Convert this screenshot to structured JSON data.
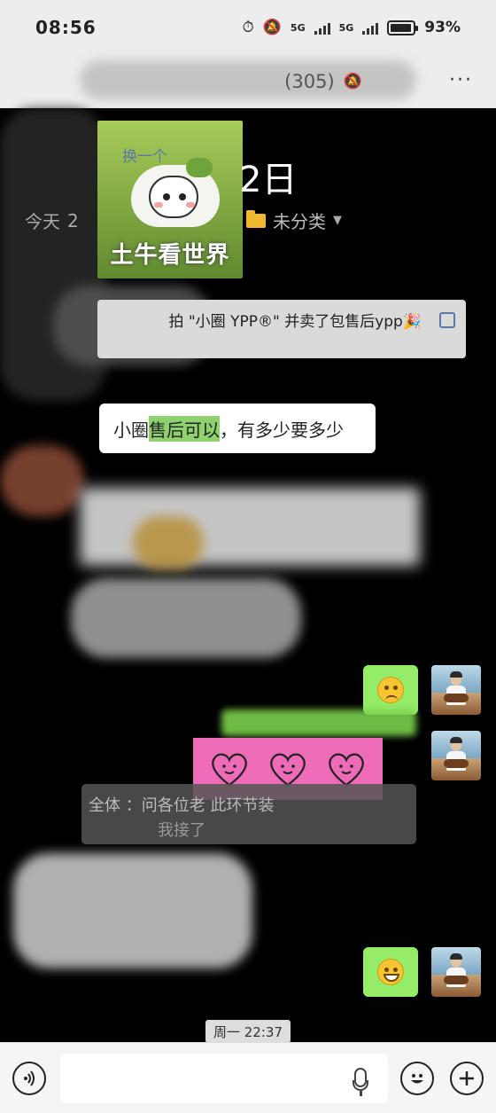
{
  "status_bar": {
    "time": "08:56",
    "signal_1": "5G",
    "signal_2": "5G",
    "battery": "93%"
  },
  "title_bar": {
    "title": "(305)",
    "more_label": "···"
  },
  "note": {
    "sticker_text": "土牛看世界",
    "date_fragment": "2日",
    "meta_today": "今天",
    "meta_today_suffix": "2",
    "folder_label": "未分类"
  },
  "system_message": {
    "text": "拍 \"小圈 YPP®\" 并卖了包售后ypp🎉",
    "link": "换一个"
  },
  "messages": {
    "white_prefix": "小圈",
    "white_highlight": "售后可以",
    "white_rest": "，有多少要多少",
    "grey_line1": "全体    ：问各位老           此环节装",
    "grey_line2": "我接了",
    "timestamp": "周一 22:37"
  },
  "colors": {
    "green_bubble": "#95ec69",
    "sticker_pink": "#ee6bb7",
    "bar_bg": "#ededed"
  },
  "icons": {
    "voice": "voice-icon",
    "emoji": "emoji-icon",
    "plus": "plus-icon",
    "mic": "mic-icon",
    "mute": "mute-bell-icon",
    "folder": "folder-icon"
  }
}
